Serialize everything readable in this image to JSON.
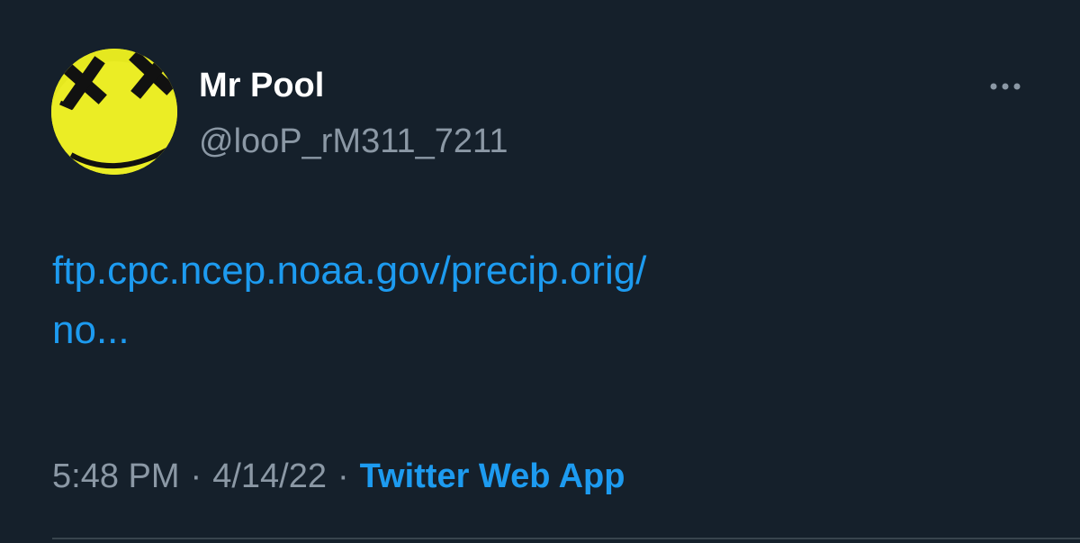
{
  "user": {
    "display_name": "Mr Pool",
    "handle": "@looP_rM311_7211",
    "avatar_icon": "yellow-smiley-avatar"
  },
  "menu": {
    "icon": "more-horizontal-icon"
  },
  "tweet": {
    "text_line1": "ftp.cpc.ncep.noaa.gov/precip.orig/",
    "text_line2": "no..."
  },
  "meta": {
    "time": "5:48 PM",
    "separator": "·",
    "date": "4/14/22",
    "source": "Twitter Web App"
  },
  "colors": {
    "background": "#15202b",
    "link": "#1d9bf0",
    "secondary_text": "#8b98a5",
    "primary_text": "#ffffff",
    "avatar_yellow": "#e6ea1c"
  }
}
